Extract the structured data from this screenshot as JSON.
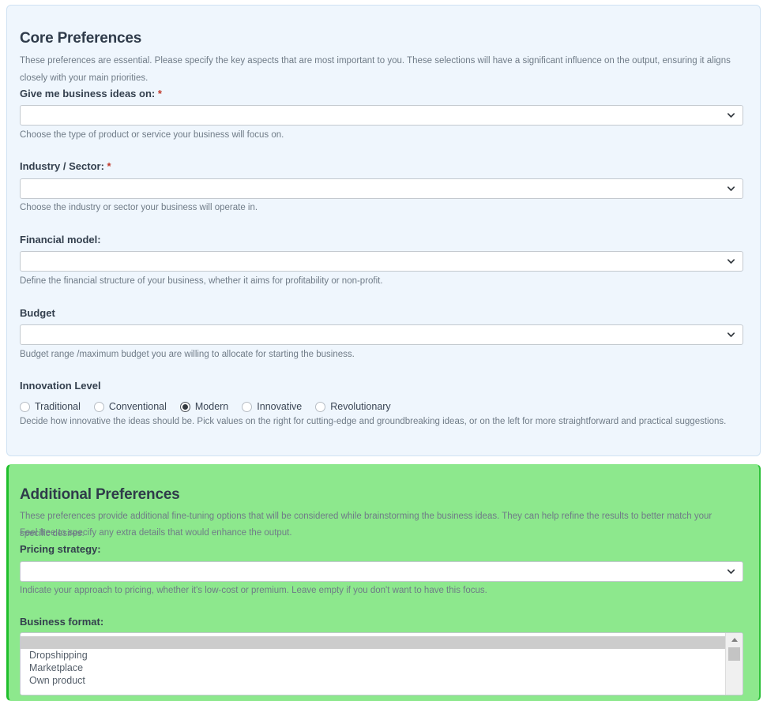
{
  "core": {
    "title": "Core Preferences",
    "description": "These preferences are essential. Please specify the key aspects that are most important to you. These selections will have a significant influence on the output, ensuring it aligns closely with your main priorities.",
    "fields": {
      "business_ideas": {
        "label": "Give me business ideas on:",
        "required_marker": "*",
        "value": "",
        "help": "Choose the type of product or service your business will focus on."
      },
      "industry": {
        "label": "Industry / Sector:",
        "required_marker": "*",
        "value": "",
        "help": "Choose the industry or sector your business will operate in."
      },
      "financial_model": {
        "label": "Financial model:",
        "value": "",
        "help": "Define the financial structure of your business, whether it aims for profitability or non-profit."
      },
      "budget": {
        "label": "Budget",
        "value": "",
        "help": "Budget range /maximum budget you are willing to allocate for starting the business."
      },
      "innovation_level": {
        "label": "Innovation Level",
        "selected": "Modern",
        "options": [
          "Traditional",
          "Conventional",
          "Modern",
          "Innovative",
          "Revolutionary"
        ],
        "help": "Decide how innovative the ideas should be. Pick values on the right for cutting-edge and groundbreaking ideas, or on the left for more straightforward and practical suggestions."
      }
    }
  },
  "additional": {
    "title": "Additional Preferences",
    "description_line1": "These preferences provide additional fine-tuning options that will be considered while brainstorming the business ideas. They can help refine the results to better match your specific desires.",
    "description_line2": "Feel free to specify any extra details that would enhance the output.",
    "fields": {
      "pricing_strategy": {
        "label": "Pricing strategy:",
        "value": "",
        "help": "Indicate your approach to pricing, whether it's low-cost or premium. Leave empty if you don't want to have this focus."
      },
      "business_format": {
        "label": "Business format:",
        "options": [
          "",
          "Dropshipping",
          "Marketplace",
          "Own product"
        ],
        "selected_index": 0
      }
    }
  },
  "icons": {
    "chevron_down": "chevron-down-icon",
    "scrollbar_up_arrow": "scroll-up-arrow-icon"
  },
  "colors": {
    "core_background": "#eff6fd",
    "core_border": "#cfe2f3",
    "additional_background": "#8de88d",
    "additional_accent": "#1fbf2b",
    "required_asterisk": "#c0392b",
    "radio_selected": "#343a40"
  }
}
